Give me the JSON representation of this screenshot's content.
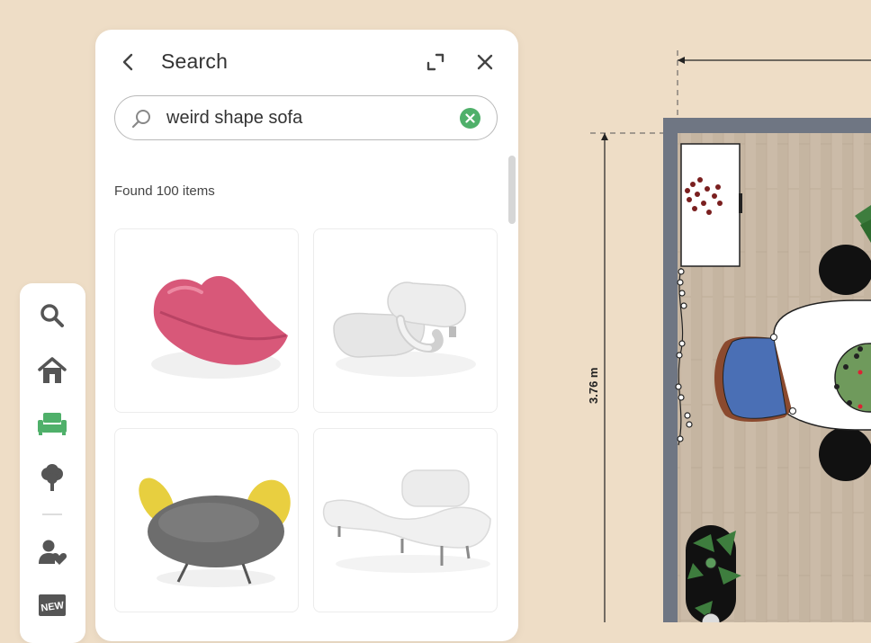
{
  "search_panel": {
    "title": "Search",
    "query": "weird shape sofa",
    "results_count_text": "Found 100 items",
    "results": [
      {
        "name": "pink-lips-sofa"
      },
      {
        "name": "white-knot-sofa"
      },
      {
        "name": "grey-ears-chair"
      },
      {
        "name": "white-wave-chaise"
      }
    ]
  },
  "toolbar": {
    "items": [
      {
        "icon": "search-icon",
        "active": false
      },
      {
        "icon": "home-icon",
        "active": false
      },
      {
        "icon": "furniture-sofa-icon",
        "active": true
      },
      {
        "icon": "tree-icon",
        "active": false
      },
      {
        "icon": "user-heart-icon",
        "active": false
      },
      {
        "icon": "new-badge-icon",
        "active": false
      }
    ],
    "new_badge_text": "NEW"
  },
  "floor_plan": {
    "dimension_label": "3.76 m"
  },
  "colors": {
    "background": "#eeddc6",
    "accent_green": "#4fb06a",
    "icon_grey": "#555555",
    "wall": "#6f7683",
    "floor": "#c9b8a4"
  }
}
